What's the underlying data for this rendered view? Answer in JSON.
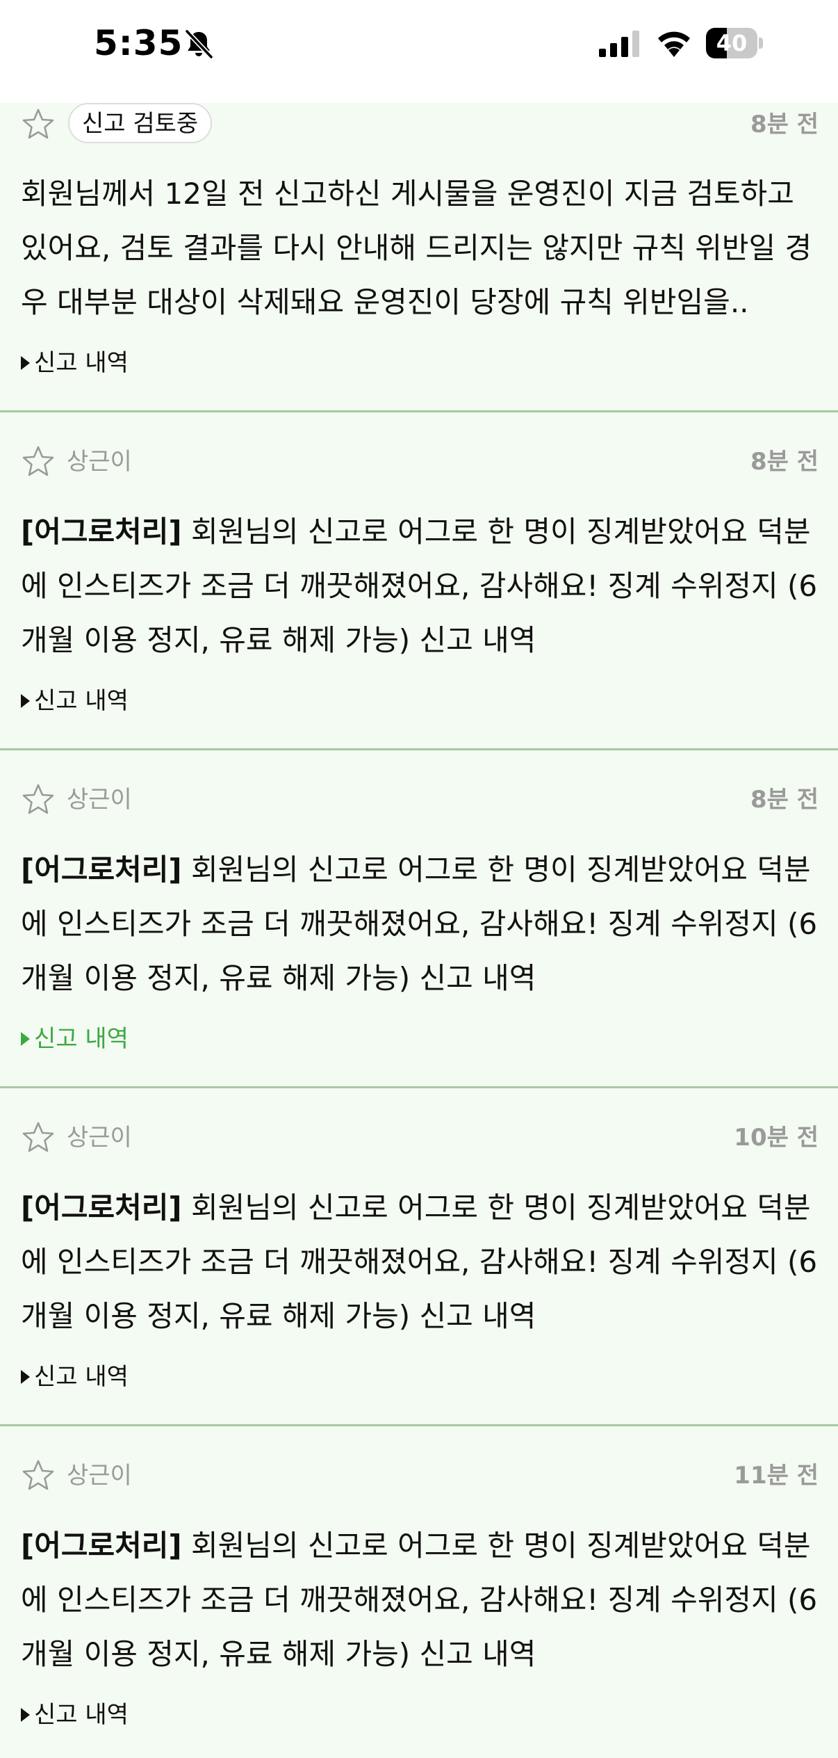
{
  "status_bar": {
    "time": "5:35",
    "battery": "40",
    "battery_level_percent": 40,
    "icons": [
      "bell-slash-icon",
      "cellular-signal-icon",
      "wifi-icon",
      "battery-icon"
    ]
  },
  "colors": {
    "item_background": "#f4fbf2",
    "divider": "#a7c9a3",
    "accent_green": "#3da843",
    "muted_text": "#9a9a9a"
  },
  "notifications": [
    {
      "status_chip": "신고 검토중",
      "time": "8분 전",
      "message": "회원님께서 12일 전 신고하신 게시물을 운영진이 지금 검토하고 있어요, 검토 결과를 다시 안내해 드리지는 않지만 규칙 위반일 경우 대부분 대상이 삭제돼요 운영진이 당장에 규칙 위반임을..",
      "toggle_label": "신고 내역"
    },
    {
      "author": "상근이",
      "time": "8분 전",
      "tag": "[어그로처리]",
      "message": " 회원님의 신고로 어그로 한 명이 징계받았어요 덕분에 인스티즈가 조금 더 깨끗해졌어요, 감사해요! 징계 수위정지 (6개월 이용 정지, 유료 해제 가능) 신고 내역",
      "toggle_label": "신고 내역"
    },
    {
      "author": "상근이",
      "time": "8분 전",
      "tag": "[어그로처리]",
      "message": " 회원님의 신고로 어그로 한 명이 징계받았어요 덕분에 인스티즈가 조금 더 깨끗해졌어요, 감사해요! 징계 수위정지 (6개월 이용 정지, 유료 해제 가능) 신고 내역",
      "toggle_label": "신고 내역"
    },
    {
      "author": "상근이",
      "time": "10분 전",
      "tag": "[어그로처리]",
      "message": " 회원님의 신고로 어그로 한 명이 징계받았어요 덕분에 인스티즈가 조금 더 깨끗해졌어요, 감사해요! 징계 수위정지 (6개월 이용 정지, 유료 해제 가능) 신고 내역",
      "toggle_label": "신고 내역"
    },
    {
      "author": "상근이",
      "time": "11분 전",
      "tag": "[어그로처리]",
      "message": " 회원님의 신고로 어그로 한 명이 징계받았어요 덕분에 인스티즈가 조금 더 깨끗해졌어요, 감사해요! 징계 수위정지 (6개월 이용 정지, 유료 해제 가능) 신고 내역",
      "toggle_label": "신고 내역"
    }
  ]
}
